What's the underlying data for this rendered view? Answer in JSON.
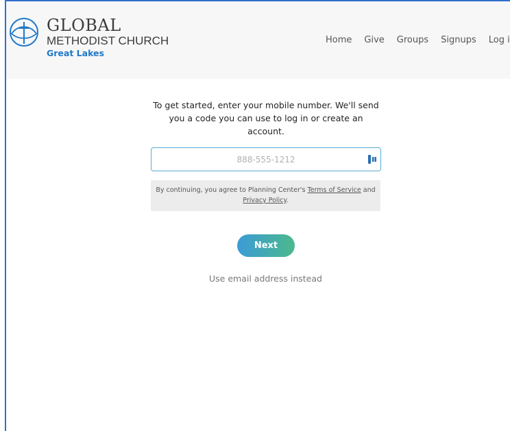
{
  "brand": {
    "line1": "GLOBAL",
    "line2": "METHODIST CHURCH",
    "line3": "Great Lakes",
    "logo_icon": "cross-circle-logo-icon",
    "accent_color": "#1e78c8"
  },
  "nav": {
    "items": [
      {
        "label": "Home"
      },
      {
        "label": "Give"
      },
      {
        "label": "Groups"
      },
      {
        "label": "Signups"
      },
      {
        "label": "Log in"
      }
    ]
  },
  "main": {
    "intro_text": "To get started, enter your mobile number. We'll send you a code you can use to log in or create an account.",
    "phone": {
      "placeholder": "888-555-1212",
      "value": "",
      "icon": "password-manager-icon"
    },
    "terms": {
      "prefix": "By continuing, you agree to Planning Center's ",
      "terms_link": "Terms of Service",
      "middle": " and ",
      "privacy_link": "Privacy Policy",
      "suffix": "."
    },
    "next_label": "Next",
    "email_link": "Use email address instead",
    "button_gradient": [
      "#3c9bd6",
      "#4bb98c"
    ]
  }
}
